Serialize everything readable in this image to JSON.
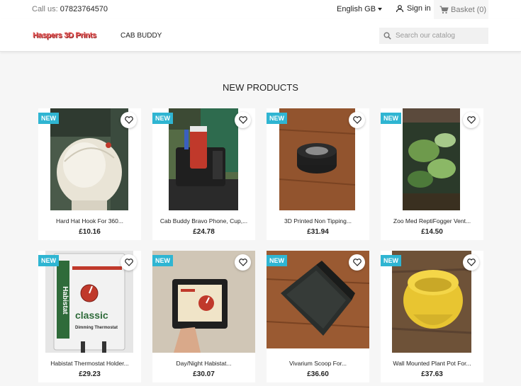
{
  "topbar": {
    "call_label": "Call us:",
    "phone": "07823764570",
    "language": "English GB",
    "signin": "Sign in",
    "basket_label": "Basket",
    "basket_count": "(0)"
  },
  "header": {
    "logo": "Haspers 3D Prints",
    "nav_item": "CAB BUDDY",
    "search_placeholder": "Search our catalog"
  },
  "section_title": "NEW PRODUCTS",
  "badge": "NEW",
  "products": [
    {
      "name": "Hard Hat Hook For 360...",
      "price": "£10.16"
    },
    {
      "name": "Cab Buddy Bravo Phone, Cup,...",
      "price": "£24.78"
    },
    {
      "name": "3D Printed Non Tipping...",
      "price": "£31.94"
    },
    {
      "name": "Zoo Med ReptiFogger Vent...",
      "price": "£14.50"
    },
    {
      "name": "Habistat Thermostat Holder...",
      "price": "£29.23"
    },
    {
      "name": "Day/Night Habistat...",
      "price": "£30.07"
    },
    {
      "name": "Vivarium Scoop For...",
      "price": "£36.60"
    },
    {
      "name": "Wall Mounted Plant Pot For...",
      "price": "£37.63"
    }
  ],
  "image_labels": {
    "thermostat_brand": "Habistat",
    "thermostat_model": "classic",
    "thermostat_caption": "Dimming Thermostat"
  },
  "colors": {
    "accent": "#2fb5d2",
    "logo": "#e85b5b",
    "background": "#f6f6f6"
  }
}
